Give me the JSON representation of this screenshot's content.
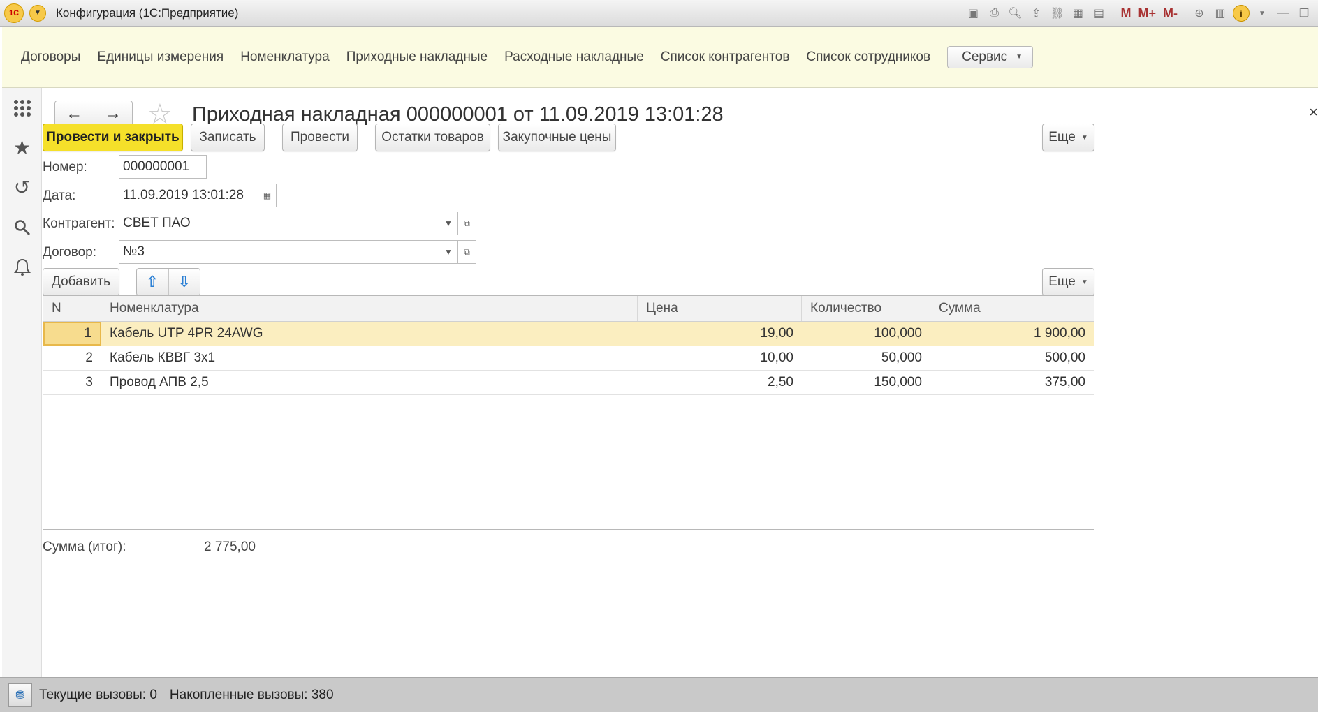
{
  "window": {
    "title": "Конфигурация  (1С:Предприятие)",
    "logo_text": "1С"
  },
  "sections": {
    "items": [
      "Договоры",
      "Единицы измерения",
      "Номенклатура",
      "Приходные накладные",
      "Расходные накладные",
      "Список контрагентов",
      "Список сотрудников"
    ],
    "service_label": "Сервис"
  },
  "form": {
    "title": "Приходная накладная 000000001 от 11.09.2019 13:01:28",
    "buttons": {
      "post_close": "Провести и закрыть",
      "save": "Записать",
      "post": "Провести",
      "stock": "Остатки товаров",
      "purchase_prices": "Закупочные цены",
      "more": "Еще"
    },
    "fields": {
      "number_label": "Номер:",
      "number_value": "000000001",
      "date_label": "Дата:",
      "date_value": "11.09.2019 13:01:28",
      "counterparty_label": "Контрагент:",
      "counterparty_value": "СВЕТ ПАО",
      "contract_label": "Договор:",
      "contract_value": "№3"
    },
    "table_toolbar": {
      "add_label": "Добавить",
      "more": "Еще"
    },
    "table": {
      "columns": [
        "N",
        "Номенклатура",
        "Цена",
        "Количество",
        "Сумма"
      ],
      "rows": [
        {
          "n": "1",
          "nom": "Кабель UTP 4PR 24AWG",
          "price": "19,00",
          "qty": "100,000",
          "sum": "1 900,00"
        },
        {
          "n": "2",
          "nom": "Кабель КВВГ 3х1",
          "price": "10,00",
          "qty": "50,000",
          "sum": "500,00"
        },
        {
          "n": "3",
          "nom": "Провод АПВ 2,5",
          "price": "2,50",
          "qty": "150,000",
          "sum": "375,00"
        }
      ]
    },
    "total_label": "Сумма (итог):",
    "total_value": "2 775,00"
  },
  "statusbar": {
    "current_calls": "Текущие вызовы: 0",
    "accumulated_calls": "Накопленные вызовы: 380"
  },
  "colors": {
    "sections_bg": "#fbfbe2",
    "primary_button": "#f5e02a",
    "selected_row": "#fbeec0",
    "arrow_blue": "#2a7fd4"
  }
}
